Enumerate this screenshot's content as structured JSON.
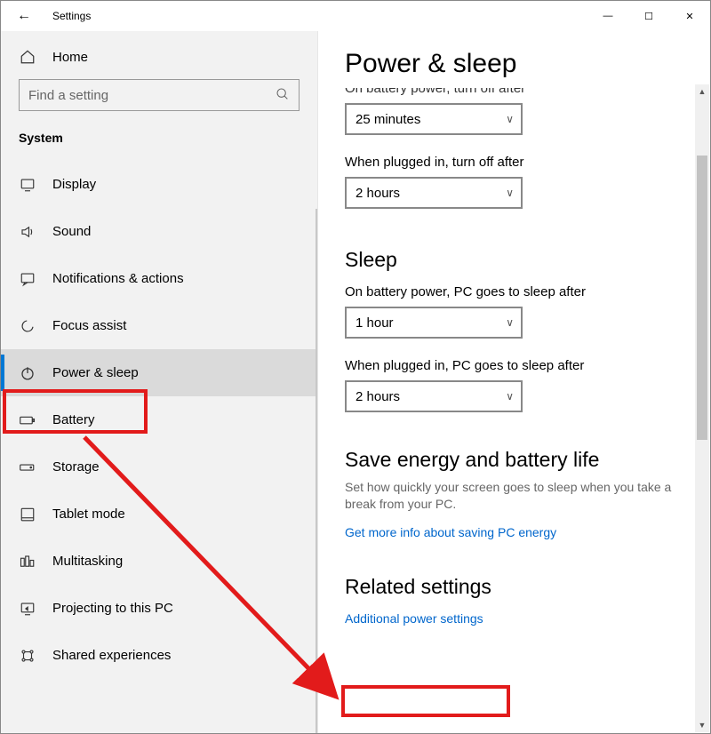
{
  "titlebar": {
    "back_glyph": "←",
    "title": "Settings",
    "min_glyph": "—",
    "max_glyph": "☐",
    "close_glyph": "✕"
  },
  "sidebar": {
    "home_label": "Home",
    "search_placeholder": "Find a setting",
    "category": "System",
    "items": [
      {
        "name": "display",
        "label": "Display",
        "selected": false
      },
      {
        "name": "sound",
        "label": "Sound",
        "selected": false
      },
      {
        "name": "notifications",
        "label": "Notifications & actions",
        "selected": false
      },
      {
        "name": "focus-assist",
        "label": "Focus assist",
        "selected": false
      },
      {
        "name": "power-sleep",
        "label": "Power & sleep",
        "selected": true
      },
      {
        "name": "battery",
        "label": "Battery",
        "selected": false
      },
      {
        "name": "storage",
        "label": "Storage",
        "selected": false
      },
      {
        "name": "tablet-mode",
        "label": "Tablet mode",
        "selected": false
      },
      {
        "name": "multitasking",
        "label": "Multitasking",
        "selected": false
      },
      {
        "name": "projecting",
        "label": "Projecting to this PC",
        "selected": false
      },
      {
        "name": "shared-experiences",
        "label": "Shared experiences",
        "selected": false
      }
    ]
  },
  "content": {
    "page_title": "Power & sleep",
    "screen_section_truncated_label": "On battery power, turn off after",
    "screen_battery_value": "25 minutes",
    "screen_plugged_label": "When plugged in, turn off after",
    "screen_plugged_value": "2 hours",
    "sleep_heading": "Sleep",
    "sleep_battery_label": "On battery power, PC goes to sleep after",
    "sleep_battery_value": "1 hour",
    "sleep_plugged_label": "When plugged in, PC goes to sleep after",
    "sleep_plugged_value": "2 hours",
    "save_heading": "Save energy and battery life",
    "save_help": "Set how quickly your screen goes to sleep when you take a break from your PC.",
    "save_link": "Get more info about saving PC energy",
    "related_heading": "Related settings",
    "related_link": "Additional power settings"
  }
}
